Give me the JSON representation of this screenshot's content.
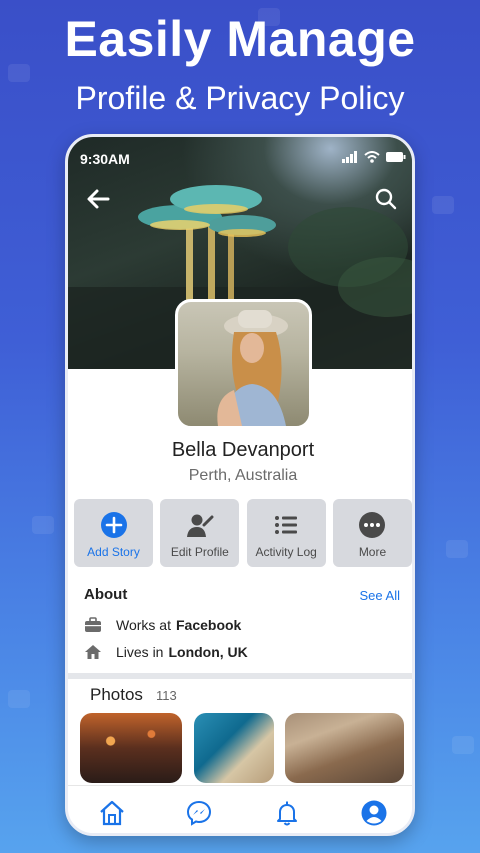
{
  "promo": {
    "headline": "Easily Manage",
    "subheadline": "Profile & Privacy Policy"
  },
  "status_bar": {
    "time": "9:30AM",
    "icons": [
      "signal-icon",
      "wifi-icon",
      "battery-icon"
    ]
  },
  "header": {
    "back_icon": "back-arrow-icon",
    "search_icon": "search-icon"
  },
  "profile": {
    "name": "Bella Devanport",
    "location": "Perth, Australia"
  },
  "actions": [
    {
      "label": "Add Story",
      "icon": "plus-circle-icon"
    },
    {
      "label": "Edit Profile",
      "icon": "edit-profile-icon"
    },
    {
      "label": "Activity Log",
      "icon": "list-icon"
    },
    {
      "label": "More",
      "icon": "more-dots-icon"
    }
  ],
  "about": {
    "title": "About",
    "see_all": "See All",
    "work_prefix": "Works at",
    "work_value": "Facebook",
    "home_prefix": "Lives in",
    "home_value": "London, UK"
  },
  "photos": {
    "title": "Photos",
    "count": "113"
  },
  "bottom_nav": [
    "home-icon",
    "messenger-icon",
    "bell-icon",
    "profile-icon"
  ],
  "colors": {
    "accent": "#1a73e8",
    "background_top": "#3a4fc8",
    "background_bottom": "#57a3ee",
    "action_bg": "#d7d9de"
  }
}
